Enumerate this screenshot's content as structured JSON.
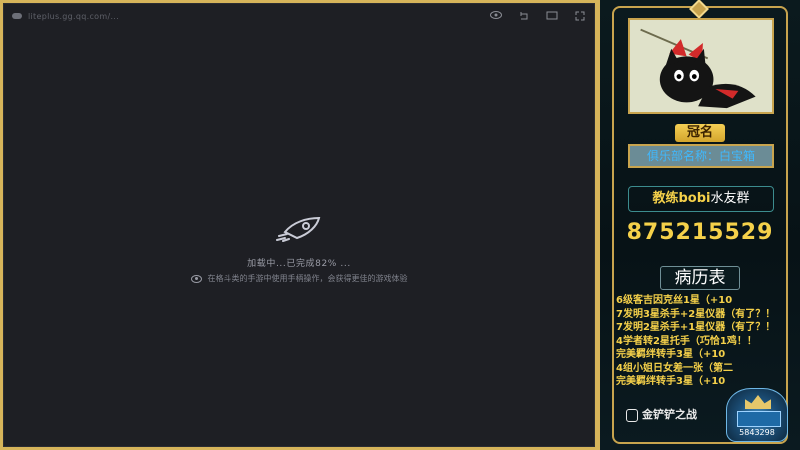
{
  "game": {
    "url": "liteplus.gg.qq.com/...",
    "progress_text": "加载中...已完成82% ...",
    "tip_text": "在格斗类的手游中使用手柄操作，会获得更佳的游戏体验",
    "toolbar_icons": [
      "eye-icon",
      "back-icon",
      "screen-icon",
      "fullscreen-icon"
    ]
  },
  "panel": {
    "crown_label": "冠名",
    "club_label": "俱乐部名称：白宝箱",
    "coach_label_a": "教练bobi",
    "coach_label_b": "水友群",
    "qq_number": "875215529",
    "history_title": "病历表",
    "history": [
      "6级客吉因克丝1星（+10",
      "7发明3星杀手+2星仪器（有了？！",
      "7发明2星杀手+1星仪器（有了？！",
      "4学者转2星托手（巧恰1鸡！！",
      "完美羁绊转手3星（+10",
      "4组小姐日女差一张（第二",
      "完美羁绊转手3星（+10"
    ],
    "logo_text": "金铲铲之战",
    "badge_number": "5843298",
    "colors": {
      "gold": "#c8a44e",
      "yellow": "#f5d14a",
      "blue": "#3fb9ff"
    }
  }
}
